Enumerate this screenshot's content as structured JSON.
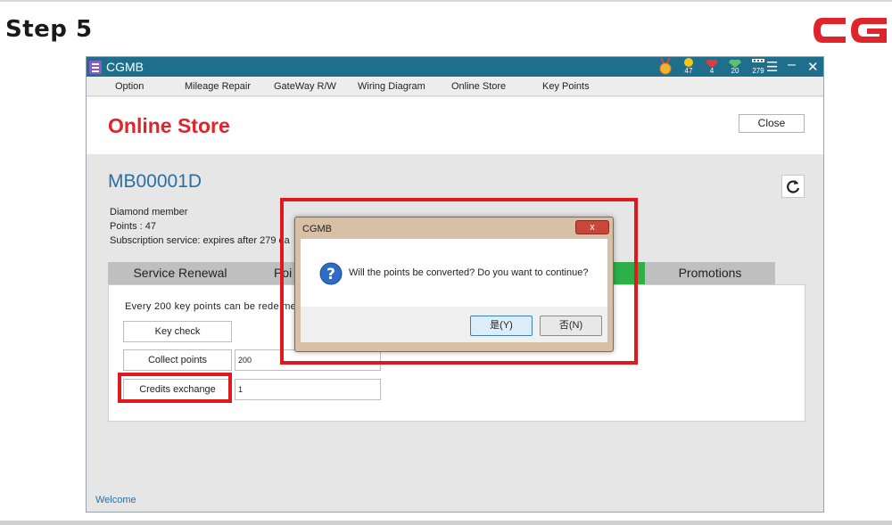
{
  "step_title": "Step 5",
  "app": {
    "title": "CGMB",
    "badges": [
      {
        "icon": "medal-icon",
        "count": "",
        "color": "#f2b233"
      },
      {
        "icon": "coin-icon",
        "count": "47",
        "color": "#f5c518"
      },
      {
        "icon": "ruby-icon",
        "count": "4",
        "color": "#e23b3b"
      },
      {
        "icon": "diamond-icon",
        "count": "20",
        "color": "#5cc26b"
      },
      {
        "icon": "counter-icon",
        "count": "279",
        "color": "#ffffff"
      }
    ],
    "menu": [
      "Option",
      "Mileage Repair",
      "GateWay R/W",
      "Wiring Diagram",
      "Online Store",
      "Key Points"
    ],
    "page_title": "Online Store",
    "close_label": "Close",
    "account_id": "MB00001D",
    "member_level": "Diamond member",
    "points_line": "Points : 47",
    "subscription_line": "Subscription service: expires after 279 da",
    "tabs": [
      "Service Renewal",
      "Poi",
      "",
      "Promotions"
    ],
    "redeem_text": "Every 200 key points can be rede me",
    "actions": {
      "key_check": "Key check",
      "collect_points": "Collect points",
      "collect_value": "200",
      "credits_exchange": "Credits exchange",
      "credits_value": "1"
    },
    "status": "Welcome",
    "colors": {
      "titlebar": "#1f6e8c",
      "accent_red": "#e0242b",
      "active_tab": "#2db04a",
      "highlight": "#e0191f"
    }
  },
  "dialog": {
    "title": "CGMB",
    "close_glyph": "x",
    "message": "Will the points be converted? Do you want to continue?",
    "yes_label": "是(Y)",
    "no_label": "否(N)"
  }
}
